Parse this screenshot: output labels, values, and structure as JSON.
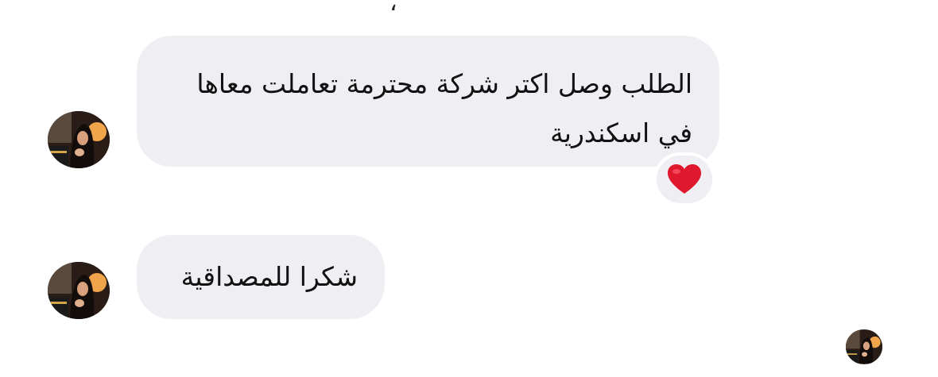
{
  "chat": {
    "top_fragment": "،",
    "messages": [
      {
        "text": "الطلب وصل اكتر شركة محترمة تعاملت معاها في اسكندرية",
        "reaction": "red-heart-icon"
      },
      {
        "text": "شكرا للمصداقية"
      }
    ]
  },
  "colors": {
    "bubble_background": "#efeff3",
    "heart": "#e0182d",
    "text": "#111111"
  }
}
